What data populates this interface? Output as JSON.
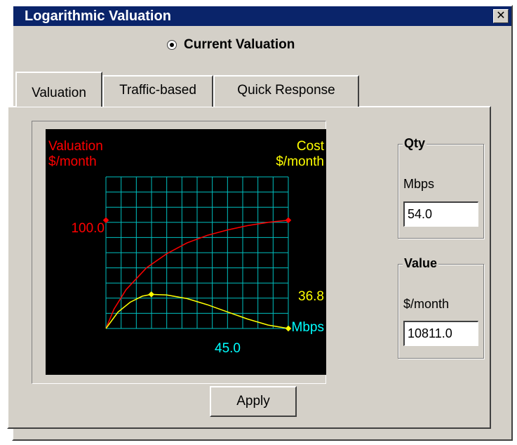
{
  "window": {
    "title": "Logarithmic Valuation",
    "close_glyph": "✕"
  },
  "mode": {
    "label": "Current Valuation",
    "selected": true
  },
  "tabs": [
    {
      "label": "Valuation",
      "active": true
    },
    {
      "label": "Traffic-based",
      "active": false
    },
    {
      "label": "Quick Response",
      "active": false
    }
  ],
  "colors": {
    "valuation": "#ff0000",
    "cost": "#ffff00",
    "grid": "#00c0c0",
    "x_axis": "#00ffff",
    "chart_bg": "#000000"
  },
  "chart_data": {
    "type": "line",
    "left_label_line1": "Valuation",
    "left_label_line2": "$/month",
    "right_label_line1": "Cost",
    "right_label_line2": "$/month",
    "x_label": "Mbps",
    "x_value_label": "45.0",
    "valuation_value_label": "100.0",
    "cost_value_label": "36.8",
    "series": [
      {
        "key": "valuation",
        "x": [
          0,
          2,
          5,
          10,
          15,
          20,
          25,
          30,
          35,
          40,
          45
        ],
        "y": [
          0,
          18,
          36,
          56,
          69,
          79,
          86,
          91,
          95,
          98,
          100
        ]
      },
      {
        "key": "cost",
        "x": [
          0,
          3,
          6,
          9,
          11.2,
          15,
          20,
          25,
          30,
          35,
          40,
          45
        ],
        "y": [
          0,
          15.2,
          24.3,
          29.9,
          31.5,
          31.0,
          27.6,
          22.0,
          15.3,
          8.7,
          3.2,
          0
        ]
      }
    ],
    "markers": [
      {
        "key": "valuation",
        "x": 0,
        "y": 100
      },
      {
        "key": "valuation",
        "x": 45,
        "y": 100
      },
      {
        "key": "cost",
        "x": 11.2,
        "y": 31.5
      },
      {
        "key": "cost",
        "x": 45,
        "y": 0
      }
    ],
    "xlim": [
      0,
      45
    ],
    "ylim": [
      0,
      140
    ],
    "grid": true
  },
  "qty": {
    "title": "Qty",
    "unit": "Mbps",
    "value": "54.0"
  },
  "value": {
    "title": "Value",
    "unit": "$/month",
    "value": "10811.0"
  },
  "apply_label": "Apply"
}
